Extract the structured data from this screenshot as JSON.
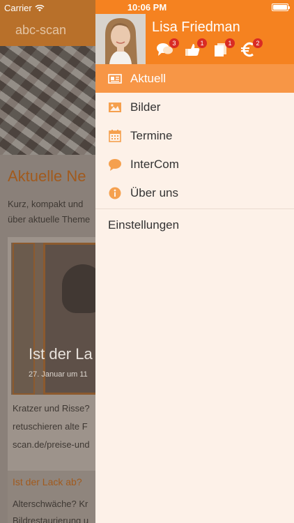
{
  "status_bar": {
    "carrier": "Carrier",
    "time": "10:06 PM"
  },
  "background": {
    "app_title": "abc-scan",
    "heading": "Aktuelle Ne",
    "intro_lines": [
      "Kurz, kompakt und",
      "über aktuelle Theme"
    ],
    "card": {
      "title": "Ist der La",
      "date": "27. Januar um 11",
      "text_lines": [
        "Kratzer und Risse?",
        "retuschieren alte F",
        "scan.de/preise-und"
      ]
    },
    "card2": {
      "title": "Ist der Lack ab?",
      "text_lines": [
        "Alterschwäche? Kr",
        "Bildrestaurierung u"
      ]
    }
  },
  "drawer": {
    "user_name": "Lisa Friedman",
    "header_icons": [
      {
        "name": "chat-icon",
        "badge": "3"
      },
      {
        "name": "thumbs-icon",
        "badge": "1"
      },
      {
        "name": "documents-icon",
        "badge": "1"
      },
      {
        "name": "euro-icon",
        "badge": "2"
      }
    ],
    "menu": [
      {
        "key": "aktuell",
        "label": "Aktuell",
        "icon": "news-icon",
        "active": true
      },
      {
        "key": "bilder",
        "label": "Bilder",
        "icon": "image-icon",
        "active": false
      },
      {
        "key": "termine",
        "label": "Termine",
        "icon": "calendar-icon",
        "active": false
      },
      {
        "key": "intercom",
        "label": "InterCom",
        "icon": "speech-bubble-icon",
        "active": false
      },
      {
        "key": "ueber-uns",
        "label": "Über uns",
        "icon": "info-icon",
        "active": false
      }
    ],
    "settings_label": "Einstellungen"
  },
  "colors": {
    "accent": "#f58220",
    "active": "#f79646",
    "drawer_bg": "#fdf1e8",
    "icon": "#f5a04e"
  }
}
